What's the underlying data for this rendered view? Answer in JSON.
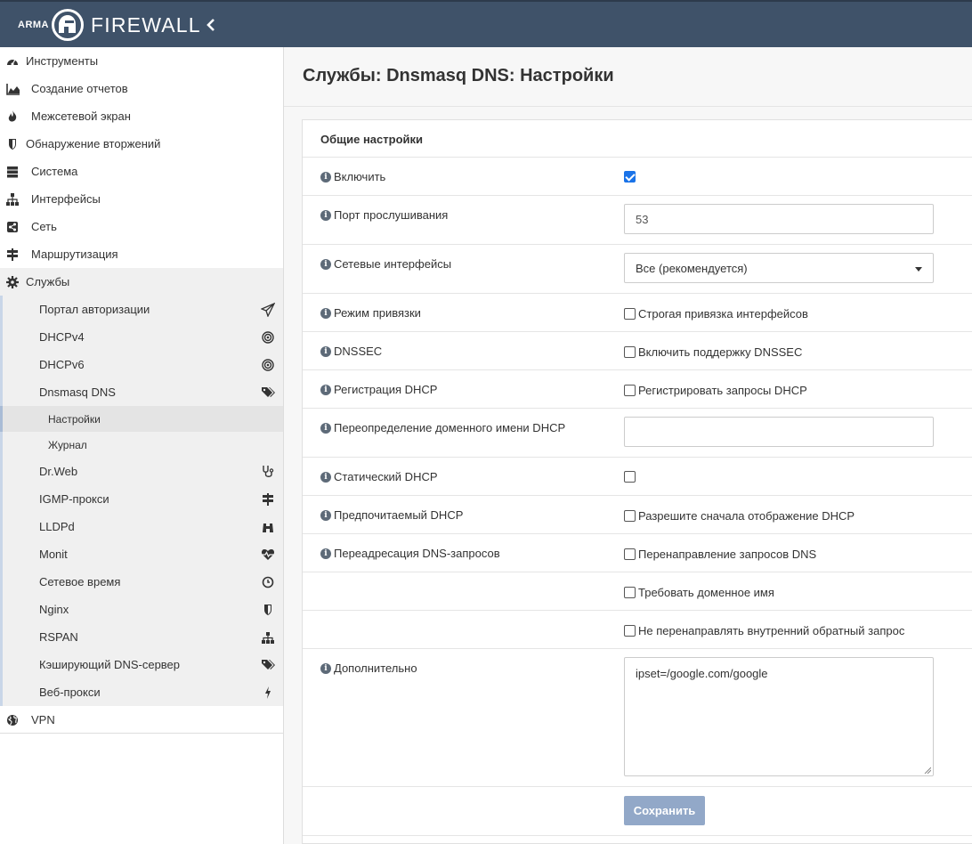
{
  "header": {
    "brand_small": "ARMA",
    "brand_large": "FIREWALL"
  },
  "sidebar": {
    "items": [
      {
        "label": "Инструменты",
        "icon": "dashboard-icon"
      },
      {
        "label": "Создание отчетов",
        "icon": "area-chart-icon"
      },
      {
        "label": "Межсетевой экран",
        "icon": "fire-icon"
      },
      {
        "label": "Обнаружение вторжений",
        "icon": "shield-icon"
      },
      {
        "label": "Система",
        "icon": "server-icon"
      },
      {
        "label": "Интерфейсы",
        "icon": "sitemap-icon"
      },
      {
        "label": "Сеть",
        "icon": "share-square-icon"
      },
      {
        "label": "Маршрутизация",
        "icon": "signpost-icon"
      },
      {
        "label": "Службы",
        "icon": "cog-icon"
      }
    ],
    "services": [
      {
        "label": "Портал авторизации",
        "icon": "paper-plane-icon"
      },
      {
        "label": "DHCPv4",
        "icon": "bullseye-icon"
      },
      {
        "label": "DHCPv6",
        "icon": "bullseye-icon"
      },
      {
        "label": "Dnsmasq DNS",
        "icon": "tags-icon"
      }
    ],
    "dnsmasq_sub": [
      {
        "label": "Настройки"
      },
      {
        "label": "Журнал"
      }
    ],
    "services2": [
      {
        "label": "Dr.Web",
        "icon": "stethoscope-icon"
      },
      {
        "label": "IGMP-прокси",
        "icon": "signpost-icon"
      },
      {
        "label": "LLDPd",
        "icon": "binoculars-icon"
      },
      {
        "label": "Monit",
        "icon": "heartbeat-icon"
      },
      {
        "label": "Сетевое время",
        "icon": "clock-icon"
      },
      {
        "label": "Nginx",
        "icon": "shield-icon"
      },
      {
        "label": "RSPAN",
        "icon": "sitemap-icon"
      },
      {
        "label": "Кэширующий DNS-сервер",
        "icon": "tags-icon"
      },
      {
        "label": "Веб-прокси",
        "icon": "bolt-icon"
      }
    ],
    "vpn": {
      "label": "VPN",
      "icon": "globe-icon"
    }
  },
  "page": {
    "title": "Службы: Dnsmasq DNS: Настройки"
  },
  "panel": {
    "heading": "Общие настройки",
    "enable_label": "Включить",
    "enable_checked": true,
    "port_label": "Порт прослушивания",
    "port_value": "53",
    "ifaces_label": "Сетевые интерфейсы",
    "ifaces_value": "Все (рекомендуется)",
    "bind_label": "Режим привязки",
    "bind_option": "Строгая привязка интерфейсов",
    "dnssec_label": "DNSSEC",
    "dnssec_option": "Включить поддержку DNSSEC",
    "dhcpreg_label": "Регистрация DHCP",
    "dhcpreg_option": "Регистрировать запросы DHCP",
    "domain_override_label": "Переопределение доменного имени DHCP",
    "domain_override_value": "",
    "static_label": "Статический DHCP",
    "pref_label": "Предпочитаемый DHCP",
    "pref_option": "Разрешите сначала отображение DHCP",
    "fwd_label": "Переадресация DNS-запросов",
    "fwd_option1": "Перенаправление запросов DNS",
    "fwd_option2": "Требовать доменное имя",
    "fwd_option3": "Не перенаправлять внутренний обратный запрос",
    "advanced_label": "Дополнительно",
    "advanced_value": "ipset=/google.com/google",
    "save_label": "Сохранить"
  }
}
